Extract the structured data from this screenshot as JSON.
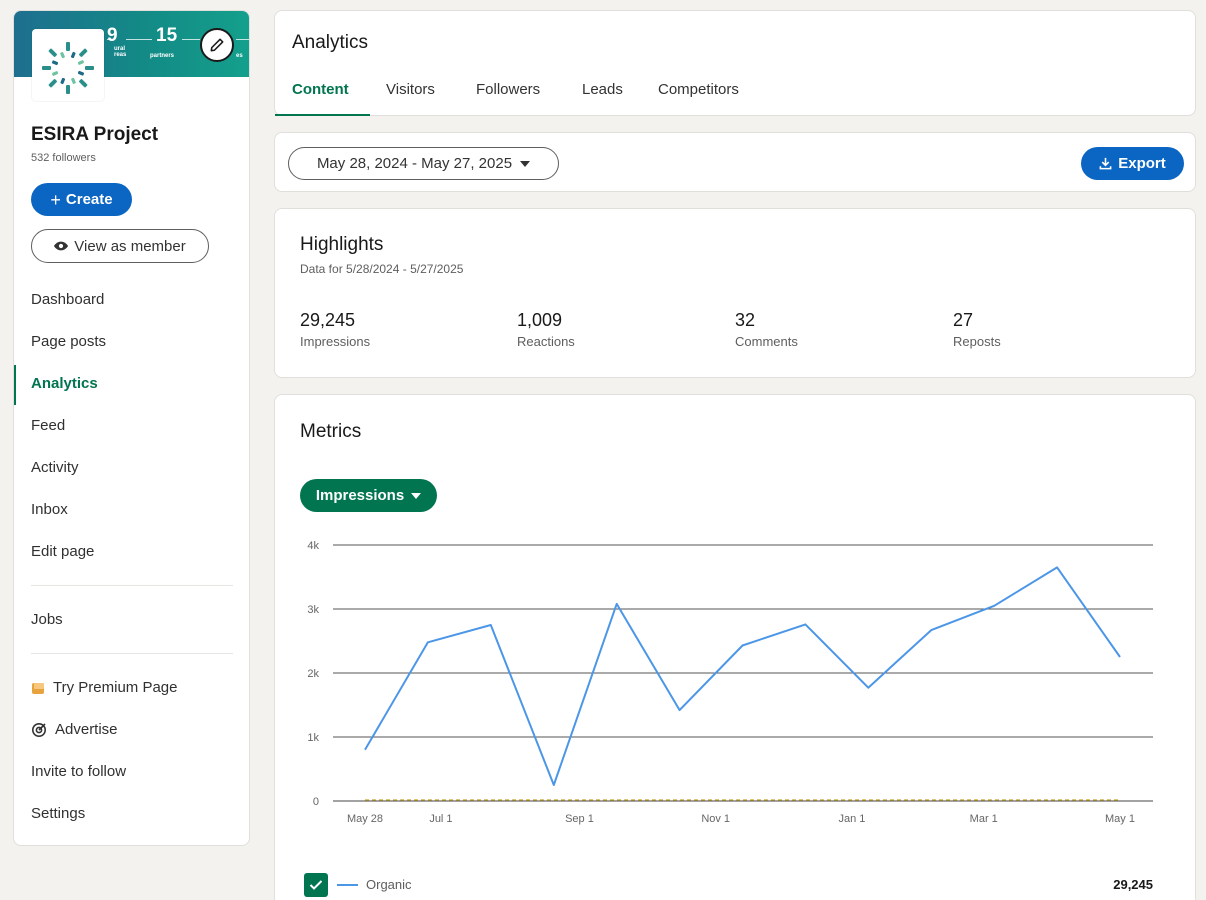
{
  "sidebar": {
    "banner": {
      "n1": "9",
      "n1_sub1": "ural",
      "n1_sub2": "reas",
      "n2": "15",
      "n2_sub": "partners",
      "n3_sub": "es"
    },
    "org_name": "ESIRA Project",
    "followers": "532 followers",
    "create_label": "Create",
    "view_member_label": "View as member",
    "nav": [
      {
        "label": "Dashboard"
      },
      {
        "label": "Page posts"
      },
      {
        "label": "Analytics",
        "active": true
      },
      {
        "label": "Feed"
      },
      {
        "label": "Activity"
      },
      {
        "label": "Inbox"
      },
      {
        "label": "Edit page"
      }
    ],
    "jobs_label": "Jobs",
    "premium_label": "Try Premium Page",
    "advertise_label": "Advertise",
    "invite_label": "Invite to follow",
    "settings_label": "Settings"
  },
  "analytics": {
    "title": "Analytics",
    "tabs": [
      {
        "label": "Content",
        "active": true
      },
      {
        "label": "Visitors"
      },
      {
        "label": "Followers"
      },
      {
        "label": "Leads"
      },
      {
        "label": "Competitors"
      }
    ]
  },
  "toolbar": {
    "date_range": "May 28, 2024 - May 27, 2025",
    "export_label": "Export"
  },
  "highlights": {
    "title": "Highlights",
    "subtitle": "Data for 5/28/2024 - 5/27/2025",
    "stats": [
      {
        "value": "29,245",
        "label": "Impressions"
      },
      {
        "value": "1,009",
        "label": "Reactions"
      },
      {
        "value": "32",
        "label": "Comments"
      },
      {
        "value": "27",
        "label": "Reposts"
      }
    ]
  },
  "metrics": {
    "title": "Metrics",
    "metric_selected": "Impressions",
    "legend": {
      "label": "Organic",
      "total": "29,245"
    }
  },
  "colors": {
    "accent_green": "#01754f",
    "accent_blue": "#0a66c2",
    "line_blue": "#4c96e8",
    "baseline_gold": "#c9a227"
  },
  "chart_data": {
    "type": "line",
    "x": [
      "2024-05-28",
      "2024-06-14",
      "2024-07-01",
      "2024-07-17",
      "2024-08-03",
      "2024-08-19",
      "2024-09-04",
      "2024-09-20",
      "2024-10-06",
      "2024-10-22",
      "2024-11-07",
      "2024-11-23",
      "2024-12-09",
      "2024-12-25",
      "2025-01-10",
      "2025-01-26",
      "2025-02-11",
      "2025-02-27",
      "2025-03-15",
      "2025-04-01",
      "2025-04-16",
      "2025-05-01"
    ],
    "x_ticks": [
      "May 28",
      "Jul 1",
      "Sep 1",
      "Nov 1",
      "Jan 1",
      "Mar 1",
      "May 1"
    ],
    "y_ticks": [
      "0",
      "1k",
      "2k",
      "3k",
      "4k"
    ],
    "ylim": [
      0,
      4000
    ],
    "series": [
      {
        "name": "Organic",
        "values": [
          800,
          2480,
          2750,
          250,
          3080,
          1420,
          2430,
          2760,
          1770,
          2670,
          3050,
          3650,
          2250
        ]
      }
    ],
    "baseline": [
      0,
      0,
      0,
      0,
      0,
      0,
      0,
      0,
      0,
      0,
      0,
      0,
      0
    ]
  }
}
